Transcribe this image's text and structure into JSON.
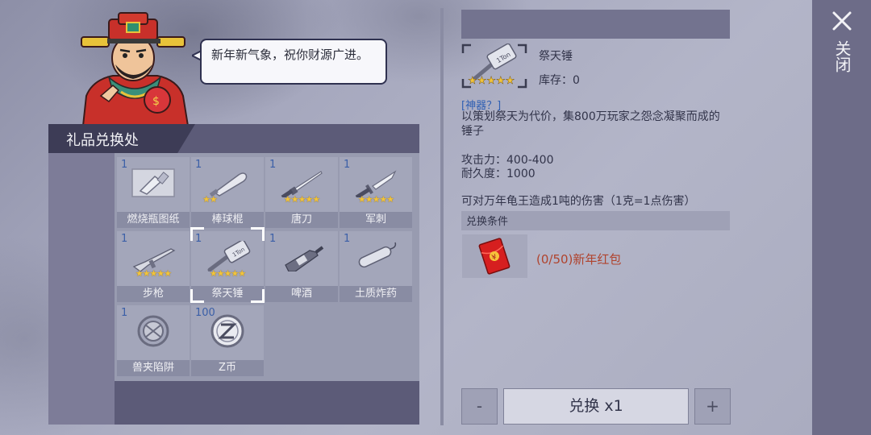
{
  "npc": {
    "speech": "新年新气象，祝你财源广进。"
  },
  "panel": {
    "title": "礼品兑换处"
  },
  "items": [
    {
      "count": "1",
      "label": "燃烧瓶图纸",
      "stars": "",
      "icon": "blueprint-icon"
    },
    {
      "count": "1",
      "label": "棒球棍",
      "stars": "★★",
      "icon": "baseball-bat-icon"
    },
    {
      "count": "1",
      "label": "唐刀",
      "stars": "★★★★★",
      "icon": "katana-icon"
    },
    {
      "count": "1",
      "label": "军刺",
      "stars": "★★★★★",
      "icon": "bayonet-icon"
    },
    {
      "count": "1",
      "label": "步枪",
      "stars": "★★★★★",
      "icon": "rifle-icon"
    },
    {
      "count": "1",
      "label": "祭天锤",
      "stars": "★★★★★",
      "icon": "hammer-icon"
    },
    {
      "count": "1",
      "label": "啤酒",
      "stars": "",
      "icon": "beer-icon"
    },
    {
      "count": "1",
      "label": "土质炸药",
      "stars": "",
      "icon": "dynamite-icon"
    },
    {
      "count": "1",
      "label": "兽夹陷阱",
      "stars": "",
      "icon": "bear-trap-icon"
    },
    {
      "count": "100",
      "label": "Z币",
      "stars": "",
      "icon": "z-coin-icon"
    }
  ],
  "selected_index": 5,
  "detail": {
    "name": "祭天锤",
    "stock": "库存：0",
    "stars": "★★★★★",
    "tag": "[神器？]",
    "description": "以策划祭天为代价，集800万玩家之怨念凝聚而成的锤子",
    "attack": "攻击力：400-400",
    "durability": "耐久度：1000",
    "effect": "可对万年龟王造成1吨的伤害（1克=1点伤害）",
    "condition_title": "兑换条件",
    "requirement": "(0/50)新年红包",
    "hammer_text": "1Ton"
  },
  "controls": {
    "minus": "-",
    "plus": "+",
    "exchange": "兑换 x1",
    "close": "关闭"
  },
  "colors": {
    "panel_dark": "#5c5b78",
    "cell_bg": "#a3a6ba",
    "count_blue": "#3b5fa7",
    "star_gold": "#f2c43a",
    "requirement_red": "#b0432d"
  }
}
